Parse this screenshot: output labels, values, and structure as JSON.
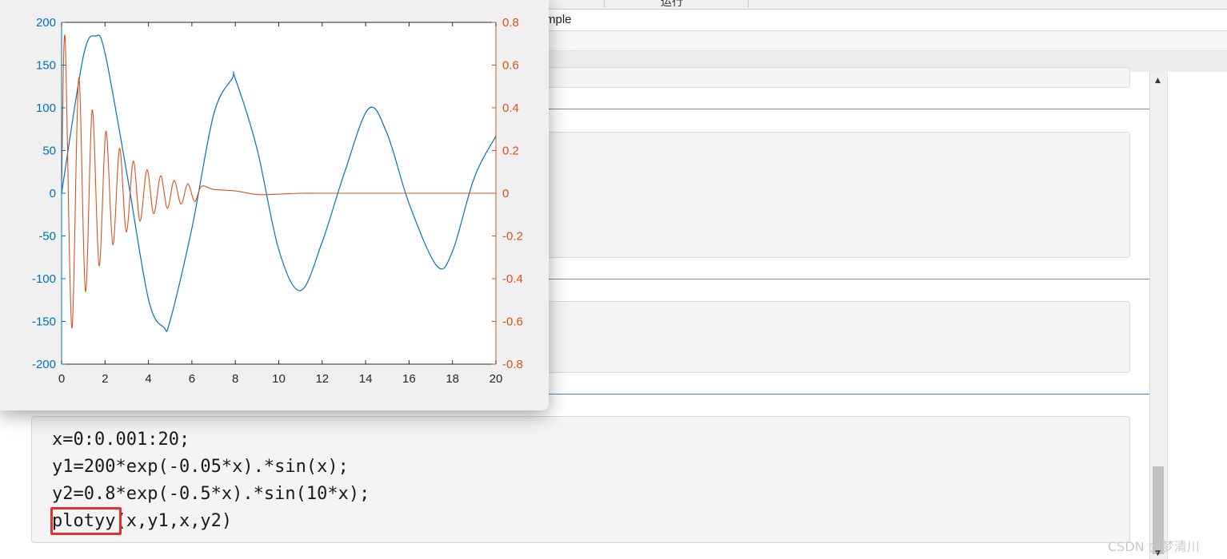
{
  "window": {
    "tab_label": "运行",
    "address_text": "mple"
  },
  "code": {
    "lines": [
      "x=0:0.001:20;",
      "y1=200*exp(-0.05*x).*sin(x);",
      "y2=0.8*exp(-0.5*x).*sin(10*x);",
      "plotyy(x,y1,x,y2)"
    ],
    "highlighted_token": "plotyy",
    "highlight_color": "#e8302a"
  },
  "watermark": "CSDN @梦清川",
  "colors": {
    "series_left": "#0072bd",
    "series_right": "#d95319"
  },
  "chart_data": {
    "type": "line",
    "title": "",
    "xlabel": "",
    "ylabel": "",
    "xlim": [
      0,
      20
    ],
    "ylim_left": [
      -200,
      200
    ],
    "ylim_right": [
      -0.8,
      0.8
    ],
    "x_ticks": [
      "0",
      "2",
      "4",
      "6",
      "8",
      "10",
      "12",
      "14",
      "16",
      "18",
      "20"
    ],
    "y_left_ticks": [
      "200",
      "150",
      "100",
      "50",
      "0",
      "-50",
      "-100",
      "-150",
      "-200"
    ],
    "y_right_ticks": [
      "0.8",
      "0.6",
      "0.4",
      "0.2",
      "0",
      "-0.2",
      "-0.4",
      "-0.6",
      "-0.8"
    ],
    "grid": false,
    "legend": "none",
    "series": [
      {
        "axis": "left",
        "color": "#0072bd",
        "x": [
          0,
          1,
          1.57,
          2,
          3,
          4,
          4.71,
          5,
          6,
          7,
          7.85,
          8,
          9,
          10,
          11,
          12,
          13,
          14.14,
          15,
          16,
          17.28,
          18,
          19,
          20
        ],
        "values": [
          0,
          160,
          184,
          164,
          24,
          -124,
          -157,
          -149,
          -41,
          92,
          134,
          134,
          52,
          -66,
          -114,
          -57,
          22,
          99,
          69,
          -12,
          -85,
          -68,
          18,
          67
        ]
      },
      {
        "axis": "right",
        "color": "#d95319",
        "x": [
          0,
          0.16,
          0.47,
          0.79,
          1.1,
          1.41,
          1.73,
          2.04,
          2.36,
          2.67,
          2.98,
          3.3,
          3.61,
          3.93,
          4.24,
          4.56,
          4.87,
          5.18,
          5.5,
          5.81,
          6.13,
          6.44,
          7,
          8,
          9,
          10,
          11,
          12,
          14,
          16,
          18,
          20
        ],
        "values": [
          0,
          0.73,
          -0.63,
          0.54,
          -0.46,
          0.39,
          -0.34,
          0.29,
          -0.24,
          0.21,
          -0.18,
          0.15,
          -0.13,
          0.11,
          -0.095,
          0.081,
          -0.07,
          0.06,
          -0.051,
          0.044,
          -0.038,
          0.032,
          0.018,
          0.011,
          -0.006,
          -0.004,
          0,
          0,
          0,
          0,
          0,
          0
        ]
      }
    ]
  }
}
